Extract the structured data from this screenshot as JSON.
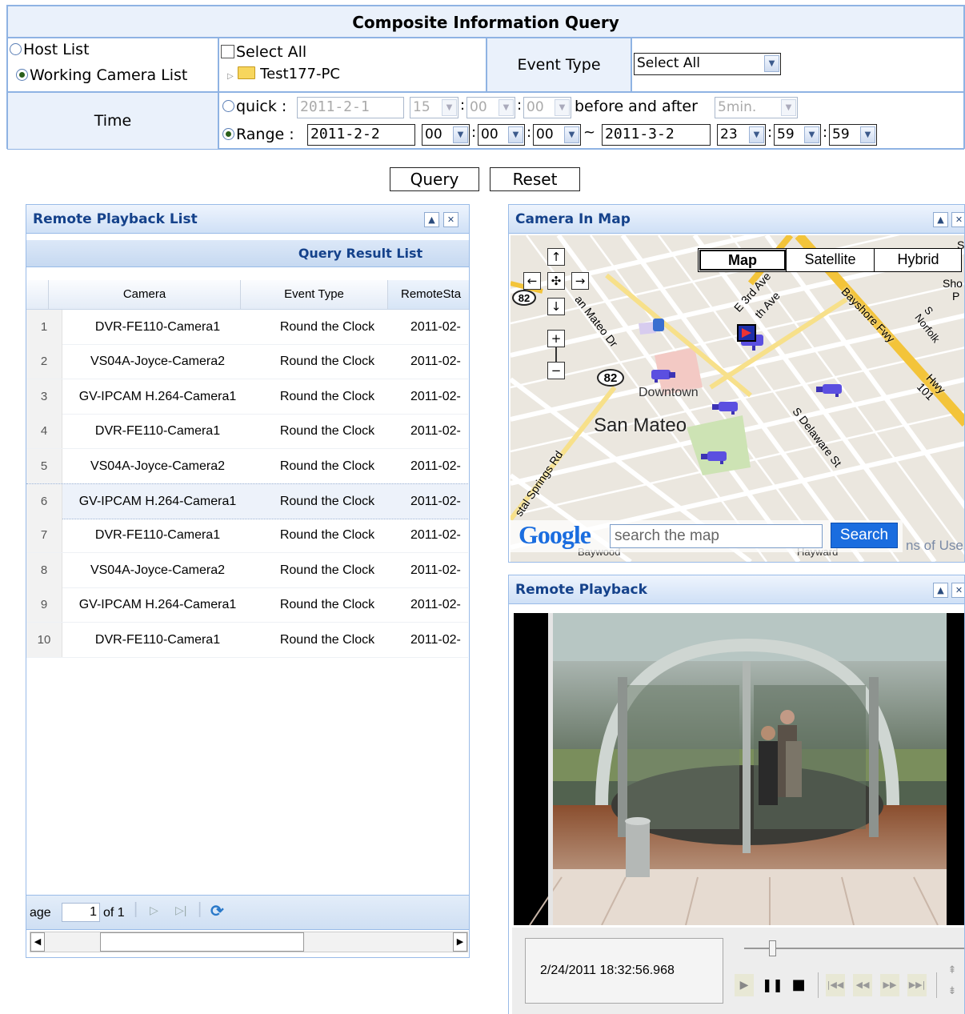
{
  "query": {
    "title": "Composite Information Query",
    "host_list_label": "Host List",
    "working_camera_label": "Working Camera List",
    "select_all_label": "Select All",
    "tree_node": "Test177-PC",
    "event_type_label": "Event Type",
    "event_type_value": "Select All",
    "time_label": "Time",
    "quick_label": "quick :",
    "quick_date": "2011-2-1",
    "quick_h": "15",
    "quick_m": "00",
    "quick_s": "00",
    "before_after_label": "before and after",
    "quick_span": "5min.",
    "range_label": "Range :",
    "range_start_date": "2011-2-2",
    "range_start_h": "00",
    "range_start_m": "00",
    "range_start_s": "00",
    "tilde": "~",
    "range_end_date": "2011-3-2",
    "range_end_h": "23",
    "range_end_m": "59",
    "range_end_s": "59",
    "query_btn": "Query",
    "reset_btn": "Reset"
  },
  "playback_list": {
    "title": "Remote Playback List",
    "subheader": "Query Result List",
    "columns": [
      "Camera",
      "Event Type",
      "RemoteSta"
    ],
    "rows": [
      {
        "n": "1",
        "camera": "DVR-FE110-Camera1",
        "event": "Round the Clock",
        "start": "2011-02-"
      },
      {
        "n": "2",
        "camera": "VS04A-Joyce-Camera2",
        "event": "Round the Clock",
        "start": "2011-02-"
      },
      {
        "n": "3",
        "camera": "GV-IPCAM H.264-Camera1",
        "event": "Round the Clock",
        "start": "2011-02-"
      },
      {
        "n": "4",
        "camera": "DVR-FE110-Camera1",
        "event": "Round the Clock",
        "start": "2011-02-"
      },
      {
        "n": "5",
        "camera": "VS04A-Joyce-Camera2",
        "event": "Round the Clock",
        "start": "2011-02-"
      },
      {
        "n": "6",
        "camera": "GV-IPCAM H.264-Camera1",
        "event": "Round the Clock",
        "start": "2011-02-"
      },
      {
        "n": "7",
        "camera": "DVR-FE110-Camera1",
        "event": "Round the Clock",
        "start": "2011-02-"
      },
      {
        "n": "8",
        "camera": "VS04A-Joyce-Camera2",
        "event": "Round the Clock",
        "start": "2011-02-"
      },
      {
        "n": "9",
        "camera": "GV-IPCAM H.264-Camera1",
        "event": "Round the Clock",
        "start": "2011-02-"
      },
      {
        "n": "10",
        "camera": "DVR-FE110-Camera1",
        "event": "Round the Clock",
        "start": "2011-02-"
      }
    ],
    "selected_row": 6,
    "pager_label": "age",
    "page_value": "1",
    "page_of": "of 1"
  },
  "map_panel": {
    "title": "Camera In Map",
    "map_btn": "Map",
    "satellite_btn": "Satellite",
    "hybrid_btn": "Hybrid",
    "labels": {
      "san_mateo": "San Mateo",
      "downtown": "Downtown",
      "route82": "82",
      "route82b": "82",
      "e3rd": "E 3rd Ave",
      "fifth": "th Ave",
      "bayshore": "Bayshore Fwy",
      "hwy101": "Hwy 101",
      "snorfolk": "S Norfolk",
      "sdelaware": "S Delaware St",
      "sanmateodr": "an Mateo Dr",
      "crystal": "stal Springs Rd",
      "sho": "Sho",
      "sho2": "P",
      "s_edge": "S",
      "baywood": "Baywood",
      "hayward": "Hayward",
      "terms": "ns of Use"
    },
    "google_logo": "Google",
    "search_placeholder": "search the map",
    "search_btn": "Search"
  },
  "playback": {
    "title": "Remote Playback",
    "timestamp": "2/24/2011 18:32:56.968",
    "position": 0.13
  },
  "colors": {
    "header_text": "#15428b",
    "border": "#99bbe8",
    "google_blue": "#1a6ddf",
    "camera_purple": "#5b4fe0"
  }
}
